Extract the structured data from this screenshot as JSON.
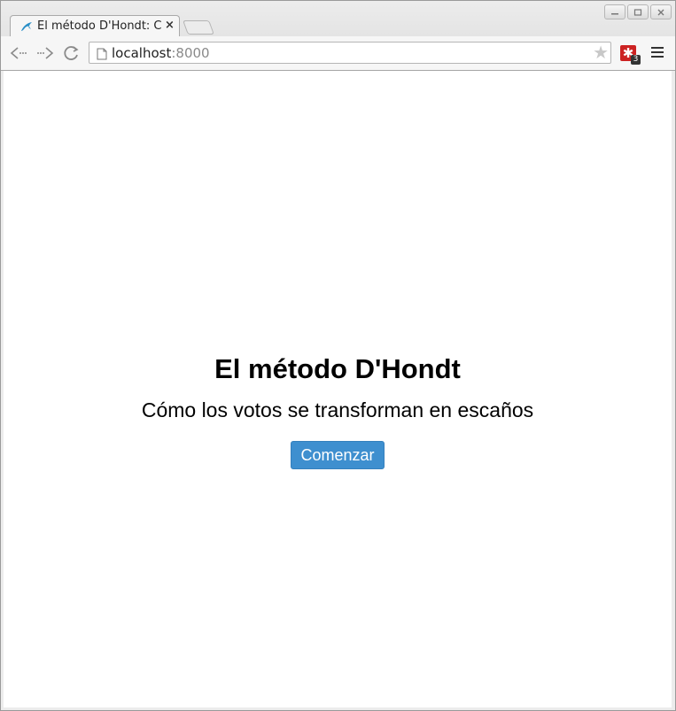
{
  "browser": {
    "tab_title": "El método D'Hondt: C",
    "tab_close": "×",
    "url_host": "localhost",
    "url_port": ":8000",
    "extension_badge": "3",
    "extension_glyph": "✱",
    "star_glyph": "★"
  },
  "page": {
    "title": "El método D'Hondt",
    "subtitle": "Cómo los votos se transforman en escaños",
    "start_button_label": "Comenzar"
  },
  "colors": {
    "button_bg": "#3e8fcf",
    "extension_red": "#cc2222",
    "favicon_blue": "#2a8fc7"
  },
  "icons": {
    "favicon": "dolphin-icon",
    "back": "back-arrow-icon",
    "forward": "forward-arrow-icon",
    "reload": "reload-icon",
    "page": "page-icon",
    "bookmark": "star-icon",
    "menu": "hamburger-menu-icon"
  }
}
